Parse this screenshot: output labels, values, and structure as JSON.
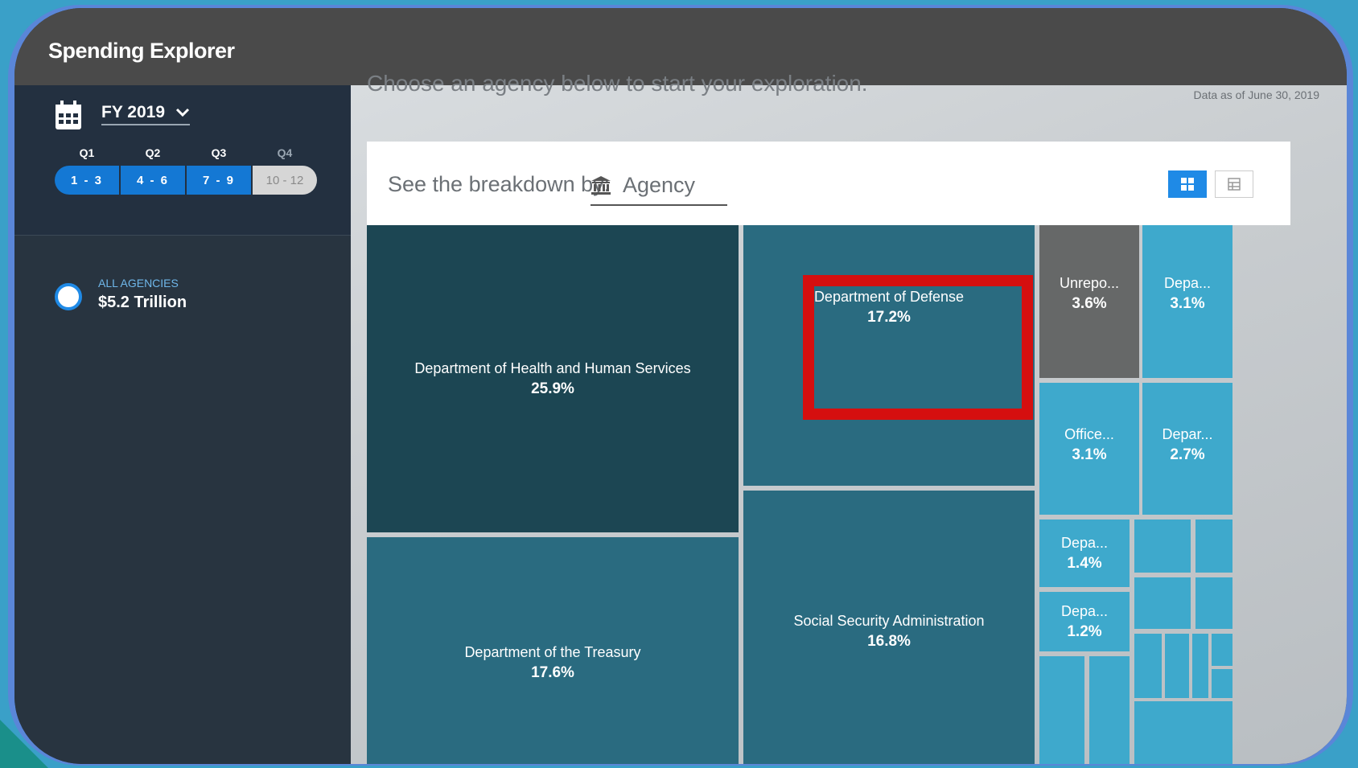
{
  "app": {
    "title": "Spending Explorer"
  },
  "period": {
    "fiscal_year": "FY 2019",
    "quarters": [
      {
        "label": "Q1",
        "months": "1 - 3",
        "selected": true
      },
      {
        "label": "Q2",
        "months": "4 - 6",
        "selected": true
      },
      {
        "label": "Q3",
        "months": "7 - 9",
        "selected": true
      },
      {
        "label": "Q4",
        "months": "10 - 12",
        "selected": false
      }
    ]
  },
  "sidebar": {
    "all_agencies_label": "ALL AGENCIES",
    "all_agencies_total": "$5.2 Trillion"
  },
  "main": {
    "intro": "Choose an agency below to start your exploration.",
    "data_date": "Data as of June 30, 2019",
    "breakdown_label": "See the breakdown by:",
    "breakdown_value": "Agency"
  },
  "treemap": [
    {
      "name": "Department of Health and Human Services",
      "pct": "25.9%"
    },
    {
      "name": "Department of the Treasury",
      "pct": "17.6%"
    },
    {
      "name": "Department of Defense",
      "pct": "17.2%"
    },
    {
      "name": "Social Security Administration",
      "pct": "16.8%"
    },
    {
      "name": "Unrepo...",
      "pct": "3.6%"
    },
    {
      "name": "Depa...",
      "pct": "3.1%"
    },
    {
      "name": "Office...",
      "pct": "3.1%"
    },
    {
      "name": "Depar...",
      "pct": "2.7%"
    },
    {
      "name": "Depa...",
      "pct": "1.4%"
    },
    {
      "name": "Depa...",
      "pct": "1.2%"
    }
  ],
  "colors": {
    "darkest": "#1c4653",
    "mid": "#2a6b80",
    "gray": "#666868",
    "light": "#3ea9cc",
    "highlight": "#d50f0f",
    "accent_blue": "#1f8ae6"
  }
}
